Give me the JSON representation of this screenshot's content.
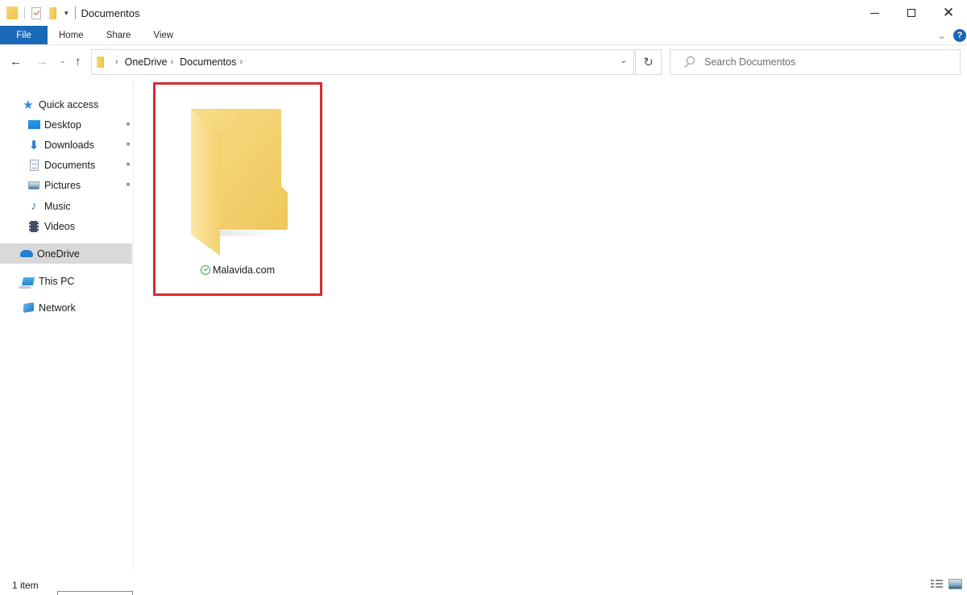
{
  "window": {
    "title": "Documentos",
    "controls": {
      "minimize": "minimize",
      "maximize": "maximize",
      "close": "✕"
    }
  },
  "quick_access_toolbar": {
    "icons": [
      "folder-icon",
      "properties-icon",
      "new-folder-icon"
    ],
    "dropdown": "▾"
  },
  "ribbon": {
    "tabs": [
      {
        "label": "File",
        "active": true
      },
      {
        "label": "Home"
      },
      {
        "label": "Share"
      },
      {
        "label": "View"
      }
    ],
    "expand_icon": "⌄",
    "help_label": "?",
    "accent_color": "#1a68b8"
  },
  "navigation": {
    "back": "←",
    "forward": "→",
    "recent": "⌄",
    "up": "↑"
  },
  "address_bar": {
    "breadcrumbs": [
      "OneDrive",
      "Documentos"
    ],
    "separator": "›",
    "dropdown": "⌄",
    "refresh": "↻"
  },
  "search": {
    "placeholder": "Search Documentos",
    "value": ""
  },
  "nav_pane": {
    "items": [
      {
        "label": "Quick access",
        "icon": "star-icon"
      },
      {
        "label": "Desktop",
        "icon": "desktop-icon",
        "pinned": true
      },
      {
        "label": "Downloads",
        "icon": "download-icon",
        "pinned": true
      },
      {
        "label": "Documents",
        "icon": "document-icon",
        "pinned": true
      },
      {
        "label": "Pictures",
        "icon": "pictures-icon",
        "pinned": true
      },
      {
        "label": "Music",
        "icon": "music-icon"
      },
      {
        "label": "Videos",
        "icon": "videos-icon"
      },
      {
        "label": "OneDrive",
        "icon": "onedrive-icon",
        "selected": true
      },
      {
        "label": "This PC",
        "icon": "this-pc-icon"
      },
      {
        "label": "Network",
        "icon": "network-icon"
      }
    ],
    "pin_glyph": "📌"
  },
  "content": {
    "items": [
      {
        "name": "Malavida.com",
        "type": "folder",
        "sync_status": "synced"
      }
    ],
    "highlight_color": "#d42b33",
    "sync_color": "#3ea653"
  },
  "status_bar": {
    "item_count": "1 item",
    "views": [
      "details-view-icon",
      "large-icons-view-icon"
    ]
  }
}
